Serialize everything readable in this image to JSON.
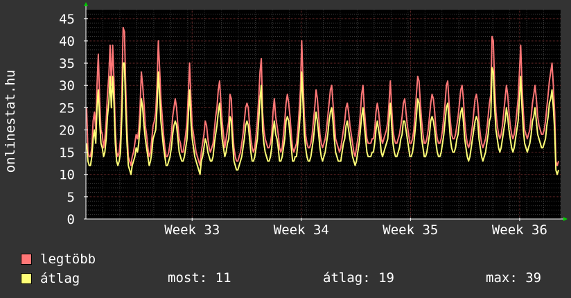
{
  "chart_data": {
    "type": "line",
    "ylabel": "onlinestat.hu",
    "ylim": [
      0,
      47
    ],
    "yticks": [
      0,
      5,
      10,
      15,
      20,
      25,
      30,
      35,
      40,
      45
    ],
    "xticks": [
      {
        "label": "Week 33",
        "pos": 0.25
      },
      {
        "label": "Week 34",
        "pos": 0.48
      },
      {
        "label": "Week 35",
        "pos": 0.71
      },
      {
        "label": "Week 36",
        "pos": 0.94
      }
    ],
    "grid": true,
    "series": [
      {
        "name": "legtöbb",
        "color": "#ff7777",
        "values": [
          25,
          15,
          14,
          14,
          16,
          22,
          24,
          20,
          30,
          37,
          27,
          20,
          19,
          16,
          18,
          22,
          28,
          32,
          39,
          30,
          39,
          31,
          20,
          15,
          14,
          15,
          18,
          28,
          43,
          42,
          30,
          20,
          14,
          13,
          12,
          14,
          15,
          17,
          19,
          18,
          20,
          25,
          33,
          30,
          26,
          21,
          19,
          16,
          14,
          15,
          18,
          21,
          22,
          24,
          30,
          40,
          34,
          27,
          23,
          19,
          16,
          14,
          14,
          15,
          17,
          19,
          23,
          25,
          27,
          25,
          21,
          18,
          17,
          15,
          15,
          17,
          19,
          22,
          28,
          35,
          27,
          21,
          19,
          17,
          15,
          14,
          13,
          12,
          15,
          17,
          19,
          22,
          21,
          18,
          16,
          15,
          16,
          17,
          20,
          23,
          25,
          29,
          31,
          26,
          22,
          19,
          16,
          18,
          20,
          22,
          28,
          27,
          20,
          16,
          14,
          13,
          13,
          14,
          15,
          17,
          19,
          22,
          25,
          26,
          25,
          21,
          18,
          16,
          15,
          16,
          19,
          22,
          27,
          33,
          36,
          24,
          20,
          18,
          17,
          16,
          16,
          17,
          19,
          24,
          27,
          23,
          21,
          19,
          16,
          15,
          16,
          19,
          22,
          26,
          28,
          26,
          23,
          19,
          16,
          15,
          16,
          17,
          20,
          24,
          29,
          40,
          31,
          23,
          19,
          17,
          16,
          16,
          17,
          19,
          22,
          25,
          29,
          27,
          23,
          19,
          17,
          16,
          17,
          18,
          20,
          23,
          26,
          29,
          30,
          26,
          22,
          18,
          17,
          16,
          15,
          16,
          18,
          20,
          22,
          25,
          26,
          24,
          21,
          19,
          17,
          15,
          14,
          16,
          18,
          20,
          24,
          28,
          30,
          25,
          21,
          18,
          17,
          17,
          17,
          18,
          18,
          20,
          24,
          26,
          24,
          21,
          18,
          17,
          18,
          19,
          20,
          22,
          26,
          31,
          25,
          20,
          18,
          17,
          17,
          18,
          19,
          21,
          23,
          26,
          27,
          24,
          21,
          19,
          17,
          17,
          18,
          20,
          24,
          28,
          32,
          31,
          26,
          22,
          19,
          17,
          17,
          18,
          20,
          23,
          26,
          28,
          27,
          24,
          20,
          18,
          17,
          17,
          18,
          20,
          23,
          26,
          30,
          31,
          26,
          22,
          19,
          18,
          18,
          19,
          21,
          23,
          26,
          29,
          30,
          27,
          22,
          19,
          17,
          16,
          17,
          19,
          21,
          24,
          27,
          28,
          26,
          22,
          19,
          17,
          16,
          17,
          18,
          20,
          23,
          26,
          28,
          41,
          40,
          30,
          24,
          21,
          19,
          18,
          19,
          21,
          24,
          27,
          30,
          28,
          24,
          21,
          19,
          18,
          19,
          21,
          24,
          27,
          33,
          39,
          30,
          24,
          20,
          19,
          18,
          19,
          20,
          23,
          26,
          28,
          30,
          27,
          23,
          21,
          20,
          19,
          19,
          20,
          22,
          25,
          28,
          31,
          33,
          35,
          30,
          24,
          13,
          12,
          13
        ]
      },
      {
        "name": "átlag",
        "color": "#ffff77",
        "values": [
          17,
          13,
          12,
          12,
          14,
          18,
          20,
          17,
          25,
          29,
          22,
          17,
          16,
          14,
          15,
          18,
          23,
          26,
          32,
          25,
          32,
          26,
          17,
          13,
          12,
          13,
          15,
          23,
          35,
          35,
          25,
          17,
          12,
          11,
          10,
          12,
          13,
          14,
          16,
          15,
          17,
          21,
          27,
          25,
          21,
          18,
          16,
          14,
          12,
          13,
          15,
          18,
          19,
          20,
          25,
          33,
          28,
          22,
          19,
          16,
          14,
          12,
          12,
          13,
          14,
          16,
          19,
          21,
          22,
          21,
          18,
          15,
          14,
          13,
          13,
          14,
          16,
          18,
          23,
          29,
          22,
          18,
          16,
          14,
          13,
          12,
          11,
          10,
          13,
          14,
          16,
          18,
          17,
          15,
          14,
          13,
          13,
          14,
          17,
          19,
          21,
          24,
          26,
          22,
          18,
          16,
          14,
          15,
          17,
          18,
          23,
          22,
          17,
          13,
          12,
          11,
          11,
          12,
          13,
          14,
          16,
          18,
          21,
          22,
          21,
          18,
          15,
          13,
          13,
          14,
          16,
          18,
          22,
          27,
          30,
          20,
          17,
          15,
          14,
          13,
          13,
          14,
          16,
          20,
          22,
          19,
          18,
          16,
          13,
          13,
          14,
          16,
          18,
          22,
          23,
          22,
          19,
          16,
          13,
          13,
          14,
          14,
          17,
          20,
          24,
          33,
          26,
          19,
          16,
          14,
          13,
          13,
          14,
          16,
          18,
          21,
          24,
          22,
          19,
          16,
          14,
          13,
          14,
          15,
          17,
          19,
          22,
          24,
          25,
          22,
          18,
          15,
          14,
          13,
          13,
          13,
          15,
          17,
          18,
          21,
          22,
          20,
          18,
          16,
          14,
          13,
          12,
          13,
          15,
          17,
          20,
          23,
          25,
          21,
          18,
          15,
          14,
          14,
          14,
          15,
          15,
          17,
          20,
          22,
          20,
          18,
          15,
          14,
          15,
          16,
          17,
          18,
          22,
          26,
          21,
          17,
          15,
          14,
          14,
          15,
          16,
          18,
          19,
          22,
          22,
          20,
          18,
          16,
          14,
          14,
          15,
          17,
          20,
          23,
          27,
          26,
          22,
          18,
          16,
          14,
          14,
          15,
          17,
          19,
          22,
          23,
          22,
          20,
          17,
          15,
          14,
          14,
          15,
          17,
          19,
          22,
          25,
          26,
          22,
          18,
          16,
          15,
          15,
          16,
          18,
          19,
          22,
          24,
          25,
          22,
          18,
          16,
          14,
          13,
          14,
          16,
          18,
          20,
          22,
          23,
          22,
          18,
          16,
          14,
          13,
          14,
          15,
          17,
          19,
          22,
          23,
          34,
          33,
          25,
          20,
          18,
          16,
          15,
          16,
          18,
          20,
          22,
          25,
          23,
          20,
          18,
          16,
          15,
          16,
          18,
          20,
          22,
          27,
          32,
          25,
          20,
          17,
          16,
          15,
          16,
          17,
          19,
          22,
          23,
          25,
          22,
          19,
          18,
          17,
          16,
          16,
          17,
          18,
          21,
          23,
          26,
          27,
          29,
          25,
          20,
          11,
          10,
          11
        ]
      }
    ]
  },
  "legend": {
    "series_labels": [
      "legtöbb",
      "átlag"
    ],
    "stats": {
      "most": "most: 11",
      "atlag": "átlag: 19",
      "max": "max: 39"
    }
  },
  "colors": {
    "background": "#333333",
    "plot_background": "#000000",
    "grid_major": "#6a2a2a",
    "grid_minor": "#3a3a3a",
    "axis": "#ffffff",
    "arrow": "#00cc00"
  }
}
